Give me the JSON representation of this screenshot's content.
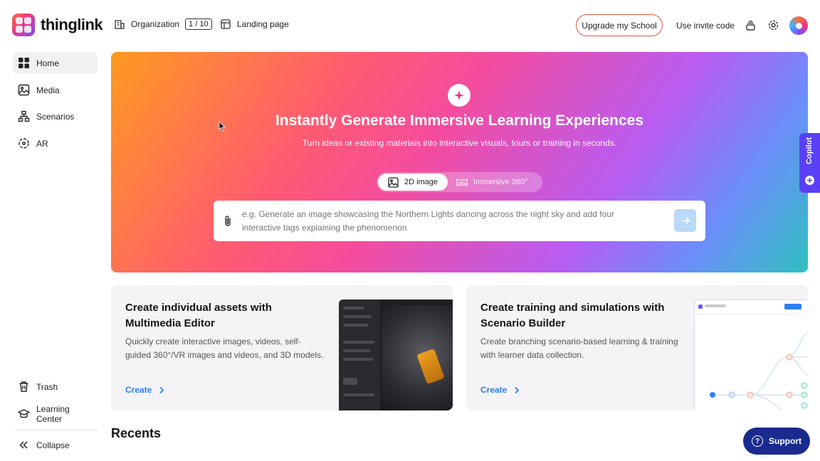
{
  "brand": {
    "name": "thinglink"
  },
  "header": {
    "organization_label": "Organization",
    "organization_badge": "1 / 10",
    "landing_label": "Landing page",
    "upgrade_label": "Upgrade my School",
    "invite_label": "Use invite code",
    "accent_color": "#e5533d"
  },
  "sidebar": {
    "items": [
      {
        "label": "Home",
        "icon": "home-grid-icon"
      },
      {
        "label": "Media",
        "icon": "media-icon"
      },
      {
        "label": "Scenarios",
        "icon": "scenarios-icon"
      },
      {
        "label": "AR",
        "icon": "ar-icon"
      }
    ],
    "bottom": [
      {
        "label": "Trash",
        "icon": "trash-icon"
      },
      {
        "label": "Learning Center",
        "icon": "graduation-cap-icon"
      },
      {
        "label": "Collapse",
        "icon": "collapse-icon"
      }
    ]
  },
  "hero": {
    "title": "Instantly Generate Immersive Learning Experiences",
    "subtitle": "Turn ideas or existing materials into interactive visuals, tours or training in seconds.",
    "mode_2d": "2D image",
    "mode_360": "Immersive 360°",
    "prompt_placeholder": "e.g. Generate an image showcasing the Northern Lights dancing across the night sky and add four interactive tags explaining the phenomenon"
  },
  "copilot": {
    "label": "Copilot",
    "color": "#5b3ff6"
  },
  "cards": [
    {
      "title": "Create individual assets with Multimedia Editor",
      "description": "Quickly create interactive images, videos, self-guided 360°/VR images and videos, and 3D models.",
      "link": "Create"
    },
    {
      "title": "Create training and simulations with Scenario Builder",
      "description": "Create branching scenario-based learning & training with learner data collection.",
      "link": "Create"
    }
  ],
  "recents": {
    "title": "Recents"
  },
  "support": {
    "label": "Support",
    "color": "#1a2b8f"
  }
}
